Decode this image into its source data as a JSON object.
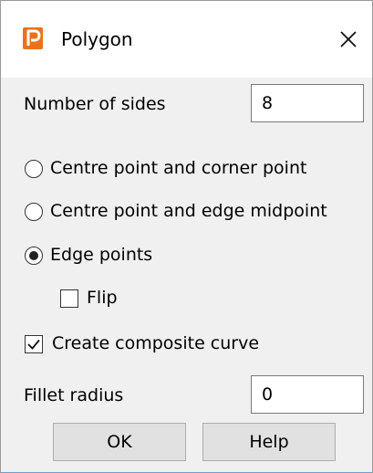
{
  "window": {
    "title": "Polygon",
    "app_icon": "P-logo-icon",
    "close_icon": "close-icon",
    "accent_color": "#e8731c"
  },
  "fields": {
    "number_of_sides_label": "Number of sides",
    "number_of_sides_value": "8",
    "fillet_radius_label": "Fillet radius",
    "fillet_radius_value": "0"
  },
  "mode": {
    "options": [
      {
        "label": "Centre point and corner point",
        "selected": false
      },
      {
        "label": "Centre point and edge midpoint",
        "selected": false
      },
      {
        "label": "Edge points",
        "selected": true
      }
    ]
  },
  "flip": {
    "label": "Flip",
    "checked": false
  },
  "composite": {
    "label": "Create composite curve",
    "checked": true
  },
  "buttons": {
    "ok_label": "OK",
    "help_label": "Help"
  }
}
